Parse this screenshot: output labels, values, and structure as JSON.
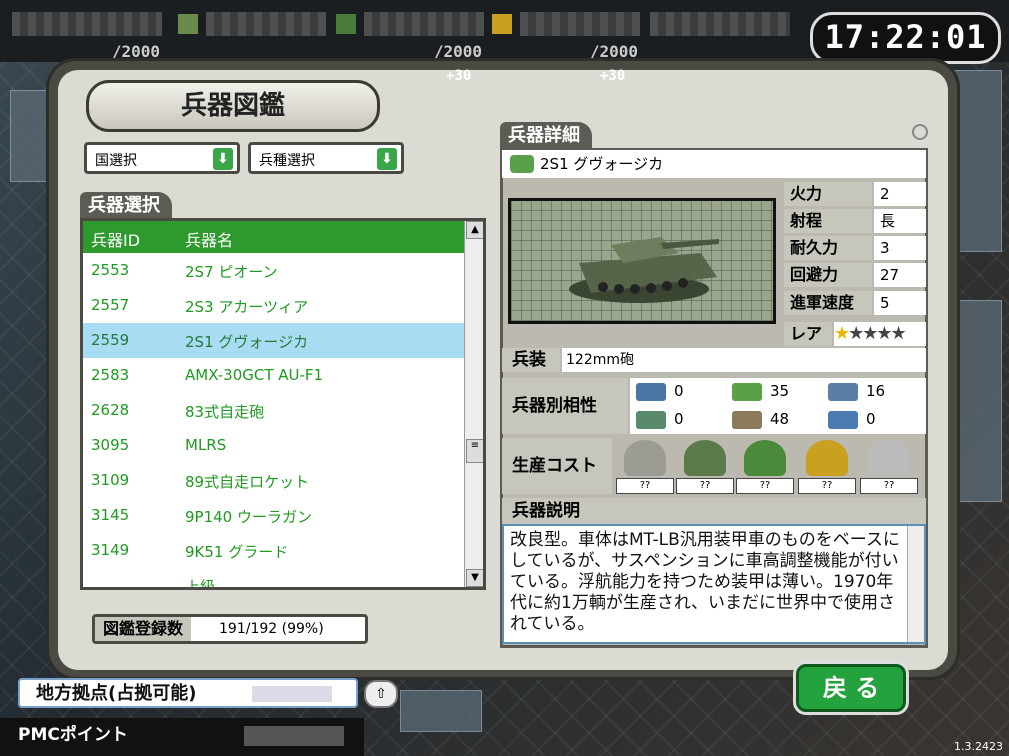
{
  "clock": "17:22:01",
  "resources": {
    "max_values": [
      "/2000",
      "/2000",
      "/2000"
    ],
    "plus_values": [
      "+30",
      "+30"
    ]
  },
  "panel_title": "兵器図鑑",
  "filters": {
    "country": "国選択",
    "type": "兵種選択"
  },
  "weapon_select": {
    "title": "兵器選択",
    "headers": {
      "id": "兵器ID",
      "name": "兵器名"
    },
    "rows": [
      {
        "id": "2553",
        "name": "2S7 ピオーン"
      },
      {
        "id": "2557",
        "name": "2S3 アカーツィア"
      },
      {
        "id": "2559",
        "name": "2S1 グヴォージカ"
      },
      {
        "id": "2583",
        "name": "AMX-30GCT AU-F1"
      },
      {
        "id": "2628",
        "name": "83式自走砲"
      },
      {
        "id": "3095",
        "name": "MLRS"
      },
      {
        "id": "3109",
        "name": "89式自走ロケット"
      },
      {
        "id": "3145",
        "name": "9P140 ウーラガン"
      },
      {
        "id": "3149",
        "name": "9K51 グラード"
      },
      {
        "id": "",
        "name": "上級"
      }
    ],
    "selected_index": 2
  },
  "registration": {
    "label": "図鑑登録数",
    "value": "191/192 (99%)"
  },
  "detail": {
    "title": "兵器詳細",
    "name": "2S1 グヴォージカ",
    "stats": [
      {
        "label": "火力",
        "value": "2"
      },
      {
        "label": "射程",
        "value": "長"
      },
      {
        "label": "耐久力",
        "value": "3"
      },
      {
        "label": "回避力",
        "value": "27"
      },
      {
        "label": "進軍速度",
        "value": "5"
      }
    ],
    "rarity_label": "レア",
    "rarity_stars": "★★★★★",
    "rarity_value": 1,
    "rarity_max": 5,
    "armament_label": "兵装",
    "armament": "122mm砲",
    "affinity_label": "兵器別相性",
    "affinity": [
      {
        "icon": "fighter-jet-icon",
        "value": "0"
      },
      {
        "icon": "tank-icon",
        "value": "35"
      },
      {
        "icon": "warship-icon",
        "value": "16"
      },
      {
        "icon": "helicopter-icon",
        "value": "0"
      },
      {
        "icon": "truck-icon",
        "value": "48"
      },
      {
        "icon": "submarine-icon",
        "value": "0"
      }
    ],
    "cost_label": "生産コスト",
    "costs": [
      {
        "icon": "resource-helmet-icon",
        "value": "??"
      },
      {
        "icon": "resource-barrel-icon",
        "value": "??"
      },
      {
        "icon": "resource-soldier-icon",
        "value": "??"
      },
      {
        "icon": "resource-gold-icon",
        "value": "??"
      },
      {
        "icon": "resource-ring-icon",
        "value": "??"
      }
    ],
    "description_label": "兵器説明",
    "description": "改良型。車体はMT-LB汎用装甲車のものをベースにしているが、サスペンションに車高調整機能が付いている。浮航能力を持つため装甲は薄い。1970年代に約1万輌が生産され、いまだに世界中で使用されている。"
  },
  "back_button": "戻 る",
  "region": "地方拠点(占拠可能)",
  "pmc_label": "PMCポイント",
  "version": "1.3.2423",
  "colors": {
    "accent_green": "#2e9a2e",
    "selected_row": "#a8dcf2",
    "back_button": "#23a23e"
  }
}
